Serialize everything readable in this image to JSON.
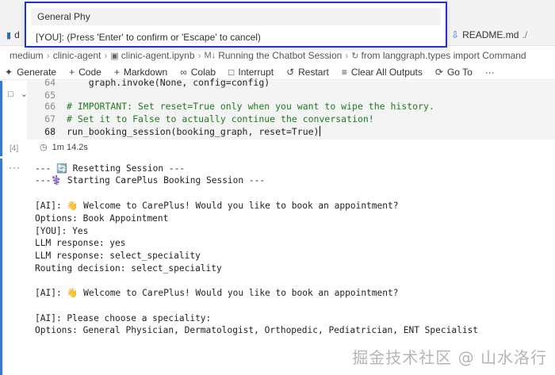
{
  "quick_input": {
    "value": "General Phy",
    "message": "[YOU]: (Press 'Enter' to confirm or 'Escape' to cancel)"
  },
  "tabs": {
    "partial_label": "d",
    "readme_label": "README.md",
    "readme_path": "./"
  },
  "breadcrumb": {
    "items": [
      "medium",
      "clinic-agent",
      "clinic-agent.ipynb",
      "Running the Chatbot Session",
      "from langgraph.types import Command"
    ]
  },
  "toolbar": {
    "generate": "Generate",
    "code": "Code",
    "markdown": "Markdown",
    "colab": "Colab",
    "interrupt": "Interrupt",
    "restart": "Restart",
    "clear": "Clear All Outputs",
    "goto": "Go To",
    "more": "···"
  },
  "cell": {
    "lines": [
      {
        "num": "64",
        "text": "    graph.invoke(None, config=config)"
      },
      {
        "num": "65",
        "text": ""
      },
      {
        "num": "66",
        "text": "# IMPORTANT: Set reset=True only when you want to wipe the history."
      },
      {
        "num": "67",
        "text": "# Set it to False to actually continue the conversation!"
      },
      {
        "num": "68",
        "text": "run_booking_session(booking_graph, reset=True)"
      }
    ],
    "exec_count": "[4]",
    "exec_time": "1m 14.2s",
    "more": "···"
  },
  "output": {
    "more": "···",
    "lines": [
      "--- 🔄 Resetting Session ---",
      "---⚕️ Starting CarePlus Booking Session ---",
      "",
      "[AI]: 👋 Welcome to CarePlus! Would you like to book an appointment?",
      "Options: Book Appointment",
      "[YOU]: Yes",
      "LLM response: yes",
      "LLM response: select_speciality",
      "Routing decision: select_speciality",
      "",
      "[AI]: 👋 Welcome to CarePlus! Would you like to book an appointment?",
      "",
      "[AI]: Please choose a speciality:",
      "Options: General Physician, Dermatologist, Orthopedic, Pediatrician, ENT Specialist"
    ]
  },
  "watermark": "掘金技术社区 @ 山水洛行",
  "colors": {
    "accent": "#2d7ad6",
    "overlay_border": "#2233cc",
    "comment": "#1f7a1f",
    "keyword": "#1a1aa6"
  }
}
